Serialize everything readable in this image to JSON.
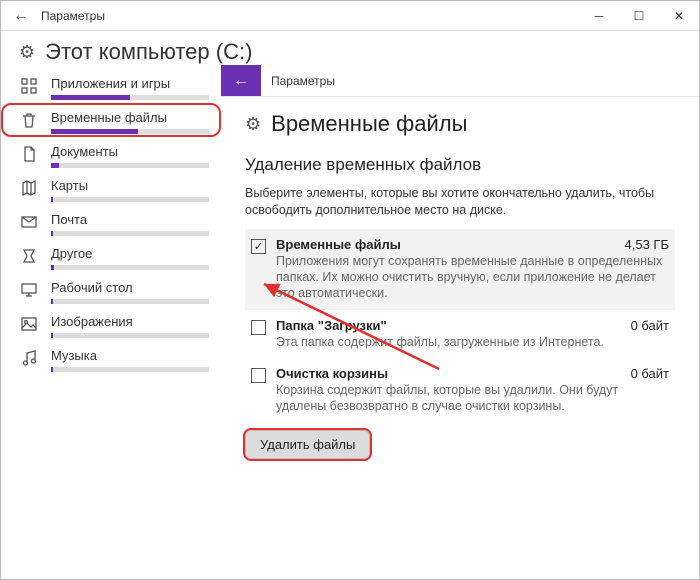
{
  "titlebar": {
    "title": "Параметры"
  },
  "crumb": "Этот компьютер (C:)",
  "sidebar": [
    {
      "label": "Приложения и игры",
      "fill": 50,
      "icon": "grid"
    },
    {
      "label": "Временные файлы",
      "fill": 55,
      "icon": "trash",
      "highlight": true
    },
    {
      "label": "Документы",
      "fill": 5,
      "icon": "doc"
    },
    {
      "label": "Карты",
      "fill": 1,
      "icon": "map"
    },
    {
      "label": "Почта",
      "fill": 1,
      "icon": "mail"
    },
    {
      "label": "Другое",
      "fill": 2,
      "icon": "other"
    },
    {
      "label": "Рабочий стол",
      "fill": 1,
      "icon": "desktop"
    },
    {
      "label": "Изображения",
      "fill": 1,
      "icon": "image"
    },
    {
      "label": "Музыка",
      "fill": 1,
      "icon": "music"
    }
  ],
  "main_head": "Параметры",
  "page_title": "Временные файлы",
  "section_title": "Удаление временных файлов",
  "section_desc": "Выберите элементы, которые вы хотите окончательно удалить, чтобы освободить дополнительное место на диске.",
  "items": [
    {
      "name": "Временные файлы",
      "size": "4,53 ГБ",
      "desc": "Приложения могут сохранять временные данные в определенных папках. Их можно очистить вручную, если приложение не делает это автоматически.",
      "checked": true
    },
    {
      "name": "Папка \"Загрузки\"",
      "size": "0 байт",
      "desc": "Эта папка содержит файлы, загруженные из Интернета.",
      "checked": false
    },
    {
      "name": "Очистка корзины",
      "size": "0 байт",
      "desc": "Корзина содержит файлы, которые вы удалили. Они будут удалены безвозвратно в случае очистки корзины.",
      "checked": false
    }
  ],
  "delete_button": "Удалить файлы"
}
